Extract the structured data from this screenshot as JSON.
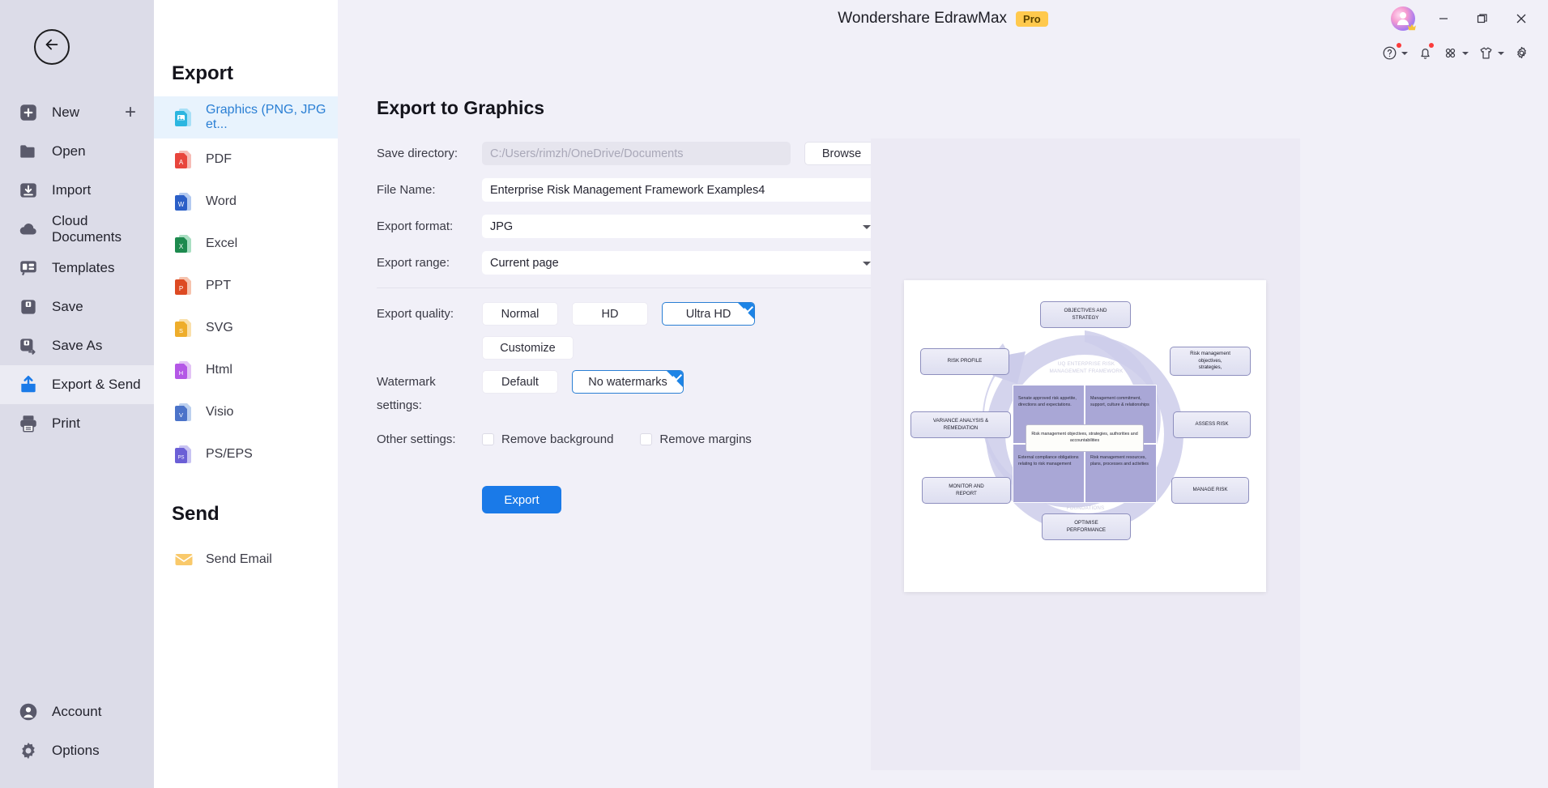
{
  "window": {
    "app_title": "Wondershare EdrawMax",
    "pro_badge": "Pro",
    "controls": {
      "minimize": "minimize-icon",
      "restore": "restore-icon",
      "close": "close-icon"
    }
  },
  "toolbar": {
    "items": [
      {
        "name": "help-icon",
        "has_caret": true,
        "has_dot": true
      },
      {
        "name": "bell-icon",
        "has_caret": false,
        "has_dot": true
      },
      {
        "name": "apps-grid-icon",
        "has_caret": true,
        "has_dot": false
      },
      {
        "name": "theme-shirt-icon",
        "has_caret": true,
        "has_dot": false
      },
      {
        "name": "gear-icon",
        "has_caret": false,
        "has_dot": false
      }
    ]
  },
  "rail": {
    "back_label": "back-arrow-icon",
    "items": [
      {
        "label": "New",
        "icon": "new-icon",
        "active": false,
        "plus": "+"
      },
      {
        "label": "Open",
        "icon": "folder-icon",
        "active": false
      },
      {
        "label": "Import",
        "icon": "import-icon",
        "active": false
      },
      {
        "label": "Cloud Documents",
        "icon": "cloud-icon",
        "active": false
      },
      {
        "label": "Templates",
        "icon": "templates-icon",
        "active": false
      },
      {
        "label": "Save",
        "icon": "save-icon",
        "active": false
      },
      {
        "label": "Save As",
        "icon": "save-as-icon",
        "active": false
      },
      {
        "label": "Export & Send",
        "icon": "export-send-icon",
        "active": true
      },
      {
        "label": "Print",
        "icon": "printer-icon",
        "active": false
      }
    ],
    "bottom": [
      {
        "label": "Account",
        "icon": "account-icon"
      },
      {
        "label": "Options",
        "icon": "options-gear-icon"
      }
    ]
  },
  "export_panel": {
    "heading": "Export",
    "formats": [
      {
        "label": "Graphics (PNG, JPG et...",
        "icon": "image-file-icon",
        "active": true
      },
      {
        "label": "PDF",
        "icon": "pdf-file-icon",
        "active": false
      },
      {
        "label": "Word",
        "icon": "word-file-icon",
        "active": false
      },
      {
        "label": "Excel",
        "icon": "excel-file-icon",
        "active": false
      },
      {
        "label": "PPT",
        "icon": "ppt-file-icon",
        "active": false
      },
      {
        "label": "SVG",
        "icon": "svg-file-icon",
        "active": false
      },
      {
        "label": "Html",
        "icon": "html-file-icon",
        "active": false
      },
      {
        "label": "Visio",
        "icon": "visio-file-icon",
        "active": false
      },
      {
        "label": "PS/EPS",
        "icon": "pseps-file-icon",
        "active": false
      }
    ],
    "send_heading": "Send",
    "send_items": [
      {
        "label": "Send Email",
        "icon": "envelope-icon"
      }
    ]
  },
  "form": {
    "title": "Export to Graphics",
    "save_directory": {
      "label": "Save directory:",
      "value": "C:/Users/rimzh/OneDrive/Documents",
      "browse_label": "Browse"
    },
    "file_name": {
      "label": "File Name:",
      "value": "Enterprise Risk Management Framework Examples4"
    },
    "export_format": {
      "label": "Export format:",
      "value": "JPG"
    },
    "export_range": {
      "label": "Export range:",
      "value": "Current page"
    },
    "export_quality": {
      "label": "Export quality:",
      "options": [
        "Normal",
        "HD",
        "Ultra HD"
      ],
      "selected": "Ultra HD",
      "customize_label": "Customize"
    },
    "watermark": {
      "label": "Watermark settings:",
      "options": [
        "Default",
        "No watermarks"
      ],
      "selected": "No watermarks"
    },
    "other_settings": {
      "label": "Other settings:",
      "checkboxes": [
        {
          "label": "Remove background",
          "checked": false
        },
        {
          "label": "Remove margins",
          "checked": false
        }
      ]
    },
    "export_button": "Export",
    "accent_color": "#1a7ae8",
    "selected_border_color": "#2a7fd4"
  },
  "preview": {
    "diagram": {
      "watermark_title": "UQ ENTERPRISE RISK\nMANAGEMENT FRAMEWORK",
      "foundations_label": "FOUNDATIONS",
      "cycle_boxes": [
        "OBJECTIVES AND\nSTRATEGY",
        "Risk management\nobjectives,\nstrategies,",
        "ASSESS RISK",
        "MANAGE RISK",
        "OPTIMISE\nPERFORMANCE",
        "MONITOR AND\nREPORT",
        "VARIANCE ANALYSIS &\nREMEDIATION",
        "RISK PROFILE"
      ],
      "quadrants": [
        "Senate approved risk appetite, directions and expectations.",
        "Management commitment, support, culture & relationships",
        "External compliance obligations relating to risk management",
        "Risk management resources, plans, processes and activities"
      ],
      "center_label": "Risk management objectives, strategies, authorities and accountabilities"
    }
  }
}
